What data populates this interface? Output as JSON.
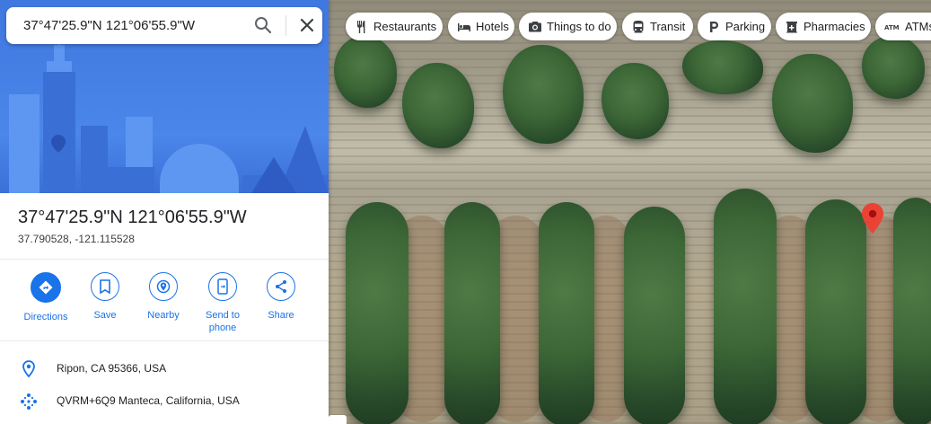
{
  "search": {
    "value": "37°47'25.9\"N 121°06'55.9\"W"
  },
  "place": {
    "title": "37°47'25.9\"N 121°06'55.9\"W",
    "coords": "37.790528, -121.115528"
  },
  "actions": [
    {
      "label": "Directions",
      "icon": "directions-icon"
    },
    {
      "label": "Save",
      "icon": "bookmark-icon"
    },
    {
      "label": "Nearby",
      "icon": "nearby-icon"
    },
    {
      "label": "Send to phone",
      "icon": "phone-icon"
    },
    {
      "label": "Share",
      "icon": "share-icon"
    }
  ],
  "info": [
    {
      "text": "Ripon, CA 95366, USA",
      "icon": "location-pin-icon"
    },
    {
      "text": "QVRM+6Q9 Manteca, California, USA",
      "icon": "plus-code-icon"
    }
  ],
  "chips": [
    {
      "label": "Restaurants",
      "icon": "fork-knife-icon"
    },
    {
      "label": "Hotels",
      "icon": "bed-icon"
    },
    {
      "label": "Things to do",
      "icon": "camera-icon"
    },
    {
      "label": "Transit",
      "icon": "train-icon"
    },
    {
      "label": "Parking",
      "icon": "parking-icon"
    },
    {
      "label": "Pharmacies",
      "icon": "pharmacy-icon"
    },
    {
      "label": "ATMs",
      "icon": "atm-icon"
    }
  ],
  "colors": {
    "accent": "#1a73e8",
    "pin": "#ea4335",
    "hero": "#4b86ea"
  }
}
